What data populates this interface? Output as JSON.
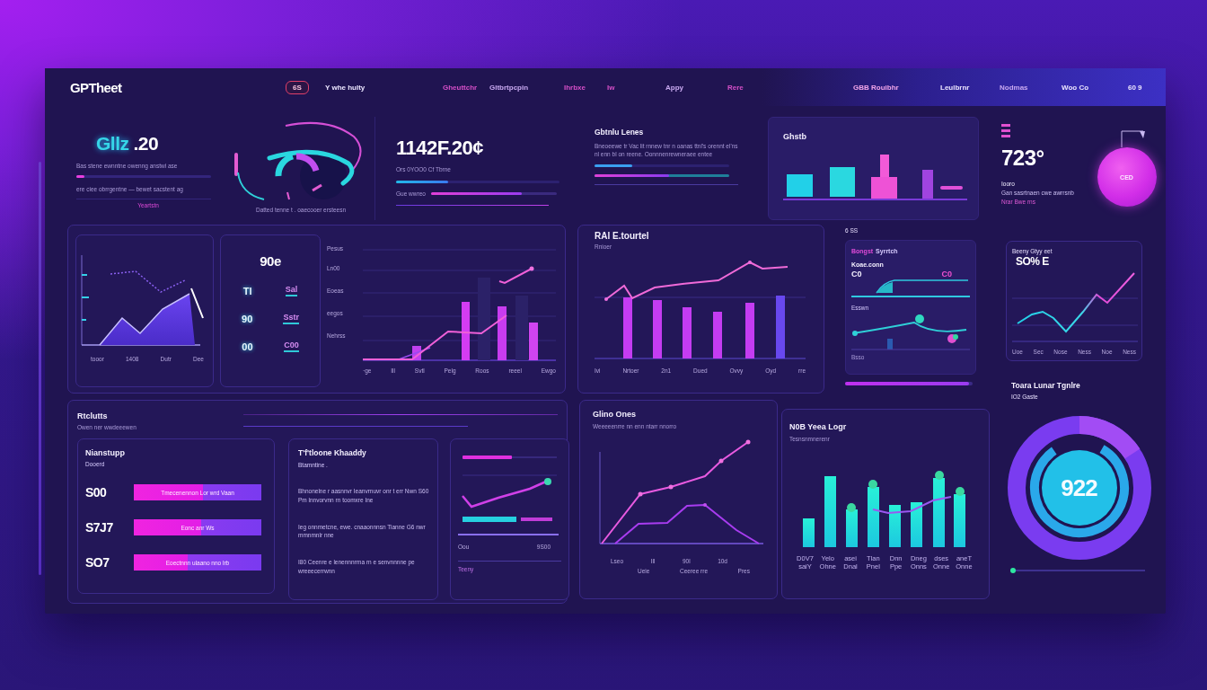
{
  "topbar": {
    "logo": "GPTheet",
    "nav": [
      {
        "label": "6S",
        "kind": "pill"
      },
      {
        "label": "Y whe hulty",
        "kind": "link"
      },
      {
        "label": "Gheuttchr",
        "kind": "accent"
      },
      {
        "label": "Gltbrtpcpin",
        "kind": "soft"
      },
      {
        "label": "Ihrbxe",
        "kind": "accent"
      },
      {
        "label": "Iw",
        "kind": "accent"
      },
      {
        "label": "Appy",
        "kind": "soft"
      },
      {
        "label": "Rere",
        "kind": "accent"
      },
      {
        "label": "GBB Rouibhr",
        "kind": "highlight"
      },
      {
        "label": "Leulbrnr",
        "kind": "link"
      },
      {
        "label": "Nodmas",
        "kind": "soft"
      },
      {
        "label": "Woo Co",
        "kind": "link"
      },
      {
        "label": "60 9",
        "kind": "link"
      }
    ]
  },
  "summary": {
    "value_lead": "Gllz",
    "value": ".20",
    "lines": [
      "Bas stene ewnntne owenng anstwi ase",
      "ere ciee obrrgentne — bewet sacstent ag"
    ],
    "meter": {
      "level": 0.06
    },
    "note": "Yeartstn",
    "caption": "Datted tenne t . oaecooer ersteesn"
  },
  "total": {
    "value": "1142F.20¢",
    "subtitle": "Ors 0YOO0 Cf Tbrne",
    "meters": [
      {
        "level": 0.32
      },
      {
        "label": "Gue wwreo",
        "level": 0.72
      }
    ]
  },
  "lines_card": {
    "title": "Gbtnlu Lenes",
    "lines": [
      "Bneoeewe tr Vac lit rnnew tnr n oanas ttnl's orennt el'ns",
      "nl enn bl on reene. Oonnnenrewneraee entee"
    ],
    "meters": [
      {
        "level": 0.28
      },
      {
        "level": 0.55
      }
    ]
  },
  "bars_card": {
    "title": "Ghstb"
  },
  "temperature": {
    "value": "723°",
    "badge": "CED",
    "lines": [
      {
        "text": "Iooro",
        "kind": "plain"
      },
      {
        "text": "Gan sasrtnaen cwe awrrsnb",
        "kind": "muted"
      },
      {
        "text": "Nrar Bwe rns",
        "kind": "accent"
      }
    ]
  },
  "area_card": {
    "x_labels": [
      "tooor",
      "1408",
      "Dutr",
      "Dee"
    ]
  },
  "count_card": {
    "value": "90e",
    "rows": [
      {
        "key": "Tl",
        "value": "Sal"
      },
      {
        "key": "90",
        "value": "Sstr"
      },
      {
        "key": "00",
        "value": "C00"
      }
    ]
  },
  "combo_chart": {
    "y_labels": [
      "Pesus",
      "Ln00",
      "Eoeas",
      "eegos",
      "Nehrss"
    ],
    "x_labels": [
      "·ge",
      "Ill",
      "Svtl",
      "Pelg",
      "Roos",
      "reeel",
      "Ewgo"
    ]
  },
  "revenue": {
    "title": "RAl E.tourtel",
    "subtitle": "Rnioer",
    "x_labels": [
      "Ivi",
      "Nrtoer",
      "2n1",
      "Dued",
      "Ovvy",
      "Oyd",
      "rre"
    ]
  },
  "signals": {
    "header": "6 SS",
    "tag": "Bongst",
    "tag_rest": "Syrrtch",
    "label": "Koae.conn",
    "left_value": "C0",
    "right_value": "C0",
    "sublabel": "Esswn",
    "footer": "Bsso",
    "meter": {
      "level": 0.97
    }
  },
  "growth": {
    "title": "Beeny Gtyy eet",
    "value": "SO% E",
    "x_labels": [
      "Uoe",
      "Sec",
      "Nose",
      "Ness",
      "Noe",
      "Ness"
    ]
  },
  "gauge": {
    "title": "Toara Lunar Tgnlre",
    "subtitle": "IO2 Gaste",
    "value": "922",
    "level": 0.82,
    "slider": {
      "level": 0.0
    }
  },
  "results": {
    "title": "Rtclutts",
    "subtitle": "Owen ner wwdeeewen",
    "breakdown": {
      "title": "Nianstupp",
      "subtitle": "Dooerd",
      "rows": [
        {
          "value": "S00",
          "text": "Tmecenennon Lor wrd Vaan",
          "level": 0.54
        },
        {
          "value": "S7J7",
          "text": "Eonc anr Ws",
          "level": 0.53
        },
        {
          "value": "SO7",
          "text": "Eoectnnn ulaano nno lrb",
          "level": 0.42
        }
      ]
    },
    "notes": {
      "title": "T'f'tloone Khaaddy",
      "subtitle": "Btamntine .",
      "paragraphs": [
        "Bhnonelne r aasnnvr Ieanvrnuvr onr t err Nwn S60 Pm lnnvorvnn rn toomxre Ine",
        "Ieg onnmetcne, ewe. cnaaonnnsn Tianne G6 nwr mmnmnlr nne",
        "I80 Ceenre e lenennnrrna rn e senvnnnne pe wreeecerrwnn"
      ]
    },
    "mini": {
      "legend_left": "Oou",
      "legend_right": "9S00",
      "footer": "Teeny"
    }
  },
  "timeline": {
    "title": "Glino Ones",
    "subtitle": "Weeeeenrre nn enn ntarr nnorro",
    "x_labels": [
      "Lseo",
      "Ill",
      "90l",
      "10d"
    ],
    "x_sublabels": [
      "Ueie",
      "Ceeree rre",
      "Pres"
    ]
  },
  "volume": {
    "title": "N0B Yeea Logr",
    "subtitle": "Tesnsnmnerenr",
    "x_labels": [
      "D0V7 saiY",
      "Yelo Ohne",
      "asei Dnal",
      "Tlan Pnel",
      "Dnn Ppe",
      "Dneg Onns",
      "dses Onne",
      "aneT Onne"
    ]
  }
}
